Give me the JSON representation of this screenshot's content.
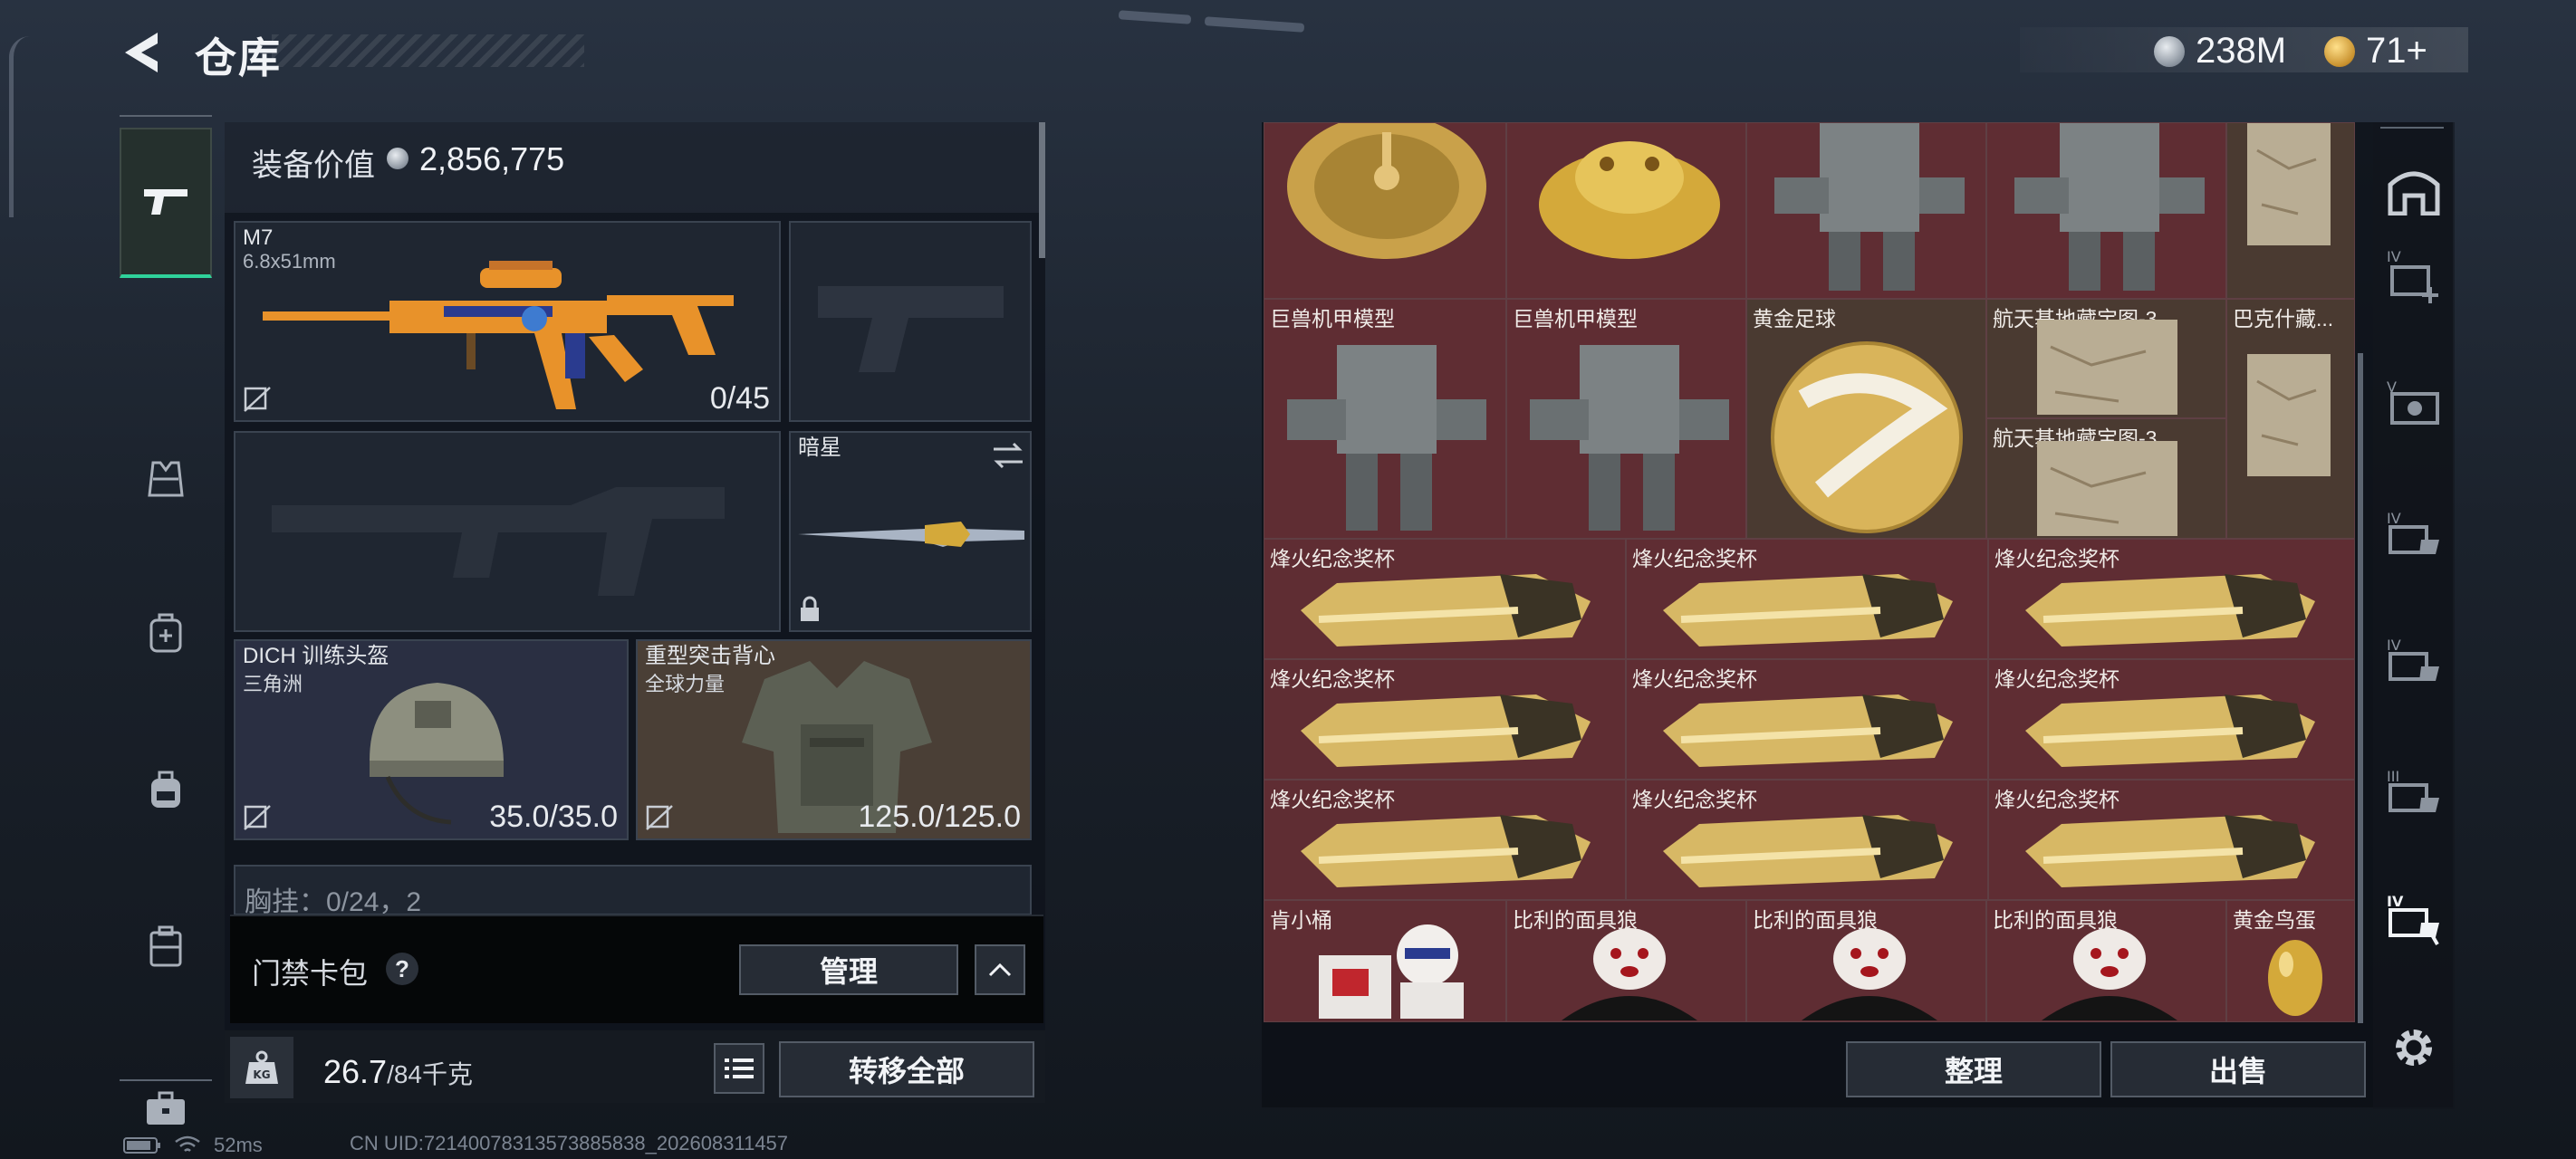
{
  "header": {
    "title": "仓库"
  },
  "currency": {
    "silver": "238M",
    "gold": "71+"
  },
  "left_nav": {
    "items": [
      {
        "icon": "pistol-icon",
        "active": true
      },
      {
        "icon": "armor-vest-icon",
        "active": false
      },
      {
        "icon": "backpack-medical-icon",
        "active": false
      },
      {
        "icon": "backpack-icon",
        "active": false
      },
      {
        "icon": "case-icon",
        "active": false
      },
      {
        "icon": "toolbox-icon",
        "active": false
      }
    ]
  },
  "equipment": {
    "value_label": "装备价值",
    "value": "2,856,775",
    "primary_weapon": {
      "name": "M7",
      "caliber": "6.8x51mm",
      "ammo": "0/45"
    },
    "melee": {
      "name": "暗星"
    },
    "helmet": {
      "name": "DICH 训练头盔",
      "faction": "三角洲",
      "durability": "35.0/35.0"
    },
    "armor": {
      "name": "重型突击背心",
      "faction": "全球力量",
      "durability": "125.0/125.0"
    },
    "chest_rig_partial": "胸挂：0/24，2"
  },
  "pass_bar": {
    "label": "门禁卡包",
    "help": "?",
    "manage_button": "管理"
  },
  "weight": {
    "current": "26.7",
    "max": "/84千克",
    "kg_badge": "KG",
    "transfer_button": "转移全部"
  },
  "storage": {
    "row2_labels": [
      "巨兽机甲模型",
      "巨兽机甲模型",
      "黄金足球",
      "航天基地藏宝图-3",
      "巴克什藏...",
      "航天基地藏宝图-3"
    ],
    "trophy_label": "烽火纪念奖杯",
    "bottom_labels": [
      "肯小桶",
      "比利的面具狼",
      "比利的面具狼",
      "比利的面具狼",
      "黄金鸟蛋"
    ],
    "sort_button": "整理",
    "sell_button": "出售"
  },
  "right_tabs": [
    "vault-icon",
    "iv-case-add-icon",
    "v-case-icon",
    "iv-case-icon",
    "iv-case-icon",
    "iii-case-icon",
    "iv-case-selected-icon",
    "settings-gear-icon"
  ],
  "status": {
    "ping": "52ms",
    "uid": "CN UID:7214007831357388583​8_202608311457"
  },
  "colors": {
    "accent_green": "#2fd29a",
    "storage_red": "#5f2d33",
    "gold": "#d4a93a",
    "weapon_orange": "#e8922a"
  }
}
